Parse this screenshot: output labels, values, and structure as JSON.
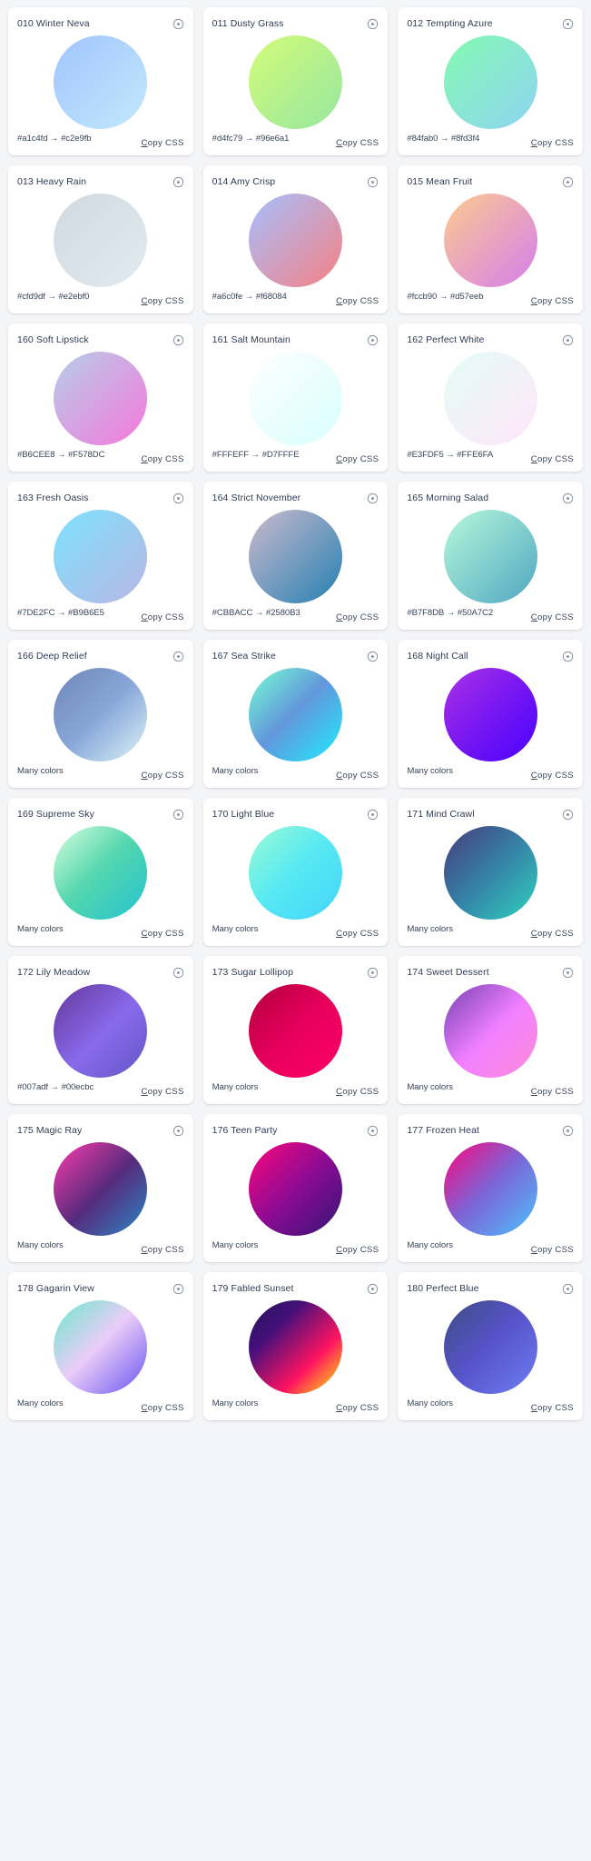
{
  "page": {
    "background": "#f4f5f7",
    "card_background": "#ffffff",
    "text_color": "#2f3b52",
    "copy_label": "Copy CSS",
    "many_colors_label": "Many colors",
    "arrow": "→",
    "info_icon": "info-circle-icon"
  },
  "cards": [
    {
      "title": "010 Winter Neva",
      "from": "#a1c4fd",
      "to": "#c2e9fb",
      "codes": "#a1c4fd → #c2e9fb",
      "copy": "Copy CSS",
      "gradient": "linear-gradient(135deg, #a1c4fd 0%, #c2e9fb 100%)"
    },
    {
      "title": "011 Dusty Grass",
      "from": "#d4fc79",
      "to": "#96e6a1",
      "codes": "#d4fc79 → #96e6a1",
      "copy": "Copy CSS",
      "gradient": "linear-gradient(135deg, #d4fc79 0%, #96e6a1 100%)"
    },
    {
      "title": "012 Tempting Azure",
      "from": "#84fab0",
      "to": "#8fd3f4",
      "codes": "#84fab0 → #8fd3f4",
      "copy": "Copy CSS",
      "gradient": "linear-gradient(135deg, #84fab0 0%, #8fd3f4 100%)"
    },
    {
      "title": "013 Heavy Rain",
      "from": "#cfd9df",
      "to": "#e2ebf0",
      "codes": "#cfd9df → #e2ebf0",
      "copy": "Copy CSS",
      "gradient": "linear-gradient(135deg, #cfd9df 0%, #e2ebf0 100%)"
    },
    {
      "title": "014 Amy Crisp",
      "from": "#a6c0fe",
      "to": "#f68084",
      "codes": "#a6c0fe → #f68084",
      "copy": "Copy CSS",
      "gradient": "linear-gradient(135deg, #a6c0fe 0%, #f68084 100%)"
    },
    {
      "title": "015 Mean Fruit",
      "from": "#fccb90",
      "to": "#d57eeb",
      "codes": "#fccb90 → #d57eeb",
      "copy": "Copy CSS",
      "gradient": "linear-gradient(135deg, #fccb90 0%, #d57eeb 100%)"
    },
    {
      "title": "160 Soft Lipstick",
      "from": "#B6CEE8",
      "to": "#F578DC",
      "codes": "#B6CEE8 → #F578DC",
      "copy": "Copy CSS",
      "gradient": "linear-gradient(135deg, #B6CEE8 0%, #F578DC 100%)"
    },
    {
      "title": "161 Salt Mountain",
      "from": "#FFFEFF",
      "to": "#D7FFFE",
      "codes": "#FFFEFF → #D7FFFE",
      "copy": "Copy CSS",
      "gradient": "linear-gradient(135deg, #FFFEFF 0%, #D7FFFE 100%)"
    },
    {
      "title": "162 Perfect White",
      "from": "#E3FDF5",
      "to": "#FFE6FA",
      "codes": "#E3FDF5 → #FFE6FA",
      "copy": "Copy CSS",
      "gradient": "linear-gradient(135deg, #E3FDF5 0%, #FFE6FA 100%)"
    },
    {
      "title": "163 Fresh Oasis",
      "from": "#7DE2FC",
      "to": "#B9B6E5",
      "codes": "#7DE2FC → #B9B6E5",
      "copy": "Copy CSS",
      "gradient": "linear-gradient(135deg, #7DE2FC 0%, #B9B6E5 100%)"
    },
    {
      "title": "164 Strict November",
      "from": "#CBBACC",
      "to": "#2580B3",
      "codes": "#CBBACC → #2580B3",
      "copy": "Copy CSS",
      "gradient": "linear-gradient(135deg, #CBBACC 0%, #2580B3 100%)"
    },
    {
      "title": "165 Morning Salad",
      "from": "#B7F8DB",
      "to": "#50A7C2",
      "codes": "#B7F8DB → #50A7C2",
      "copy": "Copy CSS",
      "gradient": "linear-gradient(135deg, #B7F8DB 0%, #50A7C2 100%)"
    },
    {
      "title": "166 Deep Relief",
      "codes": "Many colors",
      "copy": "Copy CSS",
      "gradient": "linear-gradient(135deg, #7085B6 0%, #87A7D9 50%, #DEF3F8 100%)"
    },
    {
      "title": "167 Sea Strike",
      "codes": "Many colors",
      "copy": "Copy CSS",
      "gradient": "linear-gradient(135deg, #77FFD2 0%, #6297DB 48%, #1EECFF 100%)"
    },
    {
      "title": "168 Night Call",
      "codes": "Many colors",
      "copy": "Copy CSS",
      "gradient": "linear-gradient(135deg, #AC32E4 0%, #7918F2 48%, #4801FF 100%)"
    },
    {
      "title": "169 Supreme Sky",
      "codes": "Many colors",
      "copy": "Copy CSS",
      "gradient": "linear-gradient(135deg, #D8FFDD 0%, #54D6AE 48%, #24C3D1 100%)"
    },
    {
      "title": "170 Light Blue",
      "codes": "Many colors",
      "copy": "Copy CSS",
      "gradient": "linear-gradient(135deg, #9EFBD3 0%, #57E9F2 48%, #45D4FB 100%)"
    },
    {
      "title": "171 Mind Crawl",
      "codes": "Many colors",
      "copy": "Copy CSS",
      "gradient": "linear-gradient(135deg, #473B7B 0%, #3584A7 51%, #30D2BE 100%)"
    },
    {
      "title": "172 Lily Meadow",
      "from": "#007adf",
      "to": "#00ecbc",
      "codes": "#007adf → #00ecbc",
      "copy": "Copy CSS",
      "gradient": "linear-gradient(135deg, #65379B 0%, #886AEA 53%, #6457C6 100%)"
    },
    {
      "title": "173 Sugar Lollipop",
      "codes": "Many colors",
      "copy": "Copy CSS",
      "gradient": "linear-gradient(135deg, #B3003C 0%, #E6005C 50%, #FF0066 100%)"
    },
    {
      "title": "174 Sweet Dessert",
      "codes": "Many colors",
      "copy": "Copy CSS",
      "gradient": "linear-gradient(135deg, #7742B2 0%, #F180FF 52%, #FD8BD9 100%)"
    },
    {
      "title": "175 Magic Ray",
      "codes": "Many colors",
      "copy": "Copy CSS",
      "gradient": "linear-gradient(135deg, #FF3CAC 0%, #562B7C 52%, #2B86C5 100%)"
    },
    {
      "title": "176 Teen Party",
      "codes": "Many colors",
      "copy": "Copy CSS",
      "gradient": "linear-gradient(135deg, #FF057C 0%, #8D0B93 50%, #321575 100%)"
    },
    {
      "title": "177 Frozen Heat",
      "codes": "Many colors",
      "copy": "Copy CSS",
      "gradient": "linear-gradient(135deg, #FF057C 0%, #7C64D5 48%, #4CC3FF 100%)"
    },
    {
      "title": "178 Gagarin View",
      "codes": "Many colors",
      "copy": "Copy CSS",
      "gradient": "linear-gradient(135deg, #69EACB 0%, #EACCF8 48%, #6654F1 100%)"
    },
    {
      "title": "179 Fabled Sunset",
      "codes": "Many colors",
      "copy": "Copy CSS",
      "gradient": "linear-gradient(135deg, #231557 0%, #44107A 29%, #FF1361 67%, #FFF800 100%)"
    },
    {
      "title": "180 Perfect Blue",
      "codes": "Many colors",
      "copy": "Copy CSS",
      "gradient": "linear-gradient(135deg, #3D4E81 0%, #5753C9 48%, #6E7FF3 100%)"
    }
  ]
}
